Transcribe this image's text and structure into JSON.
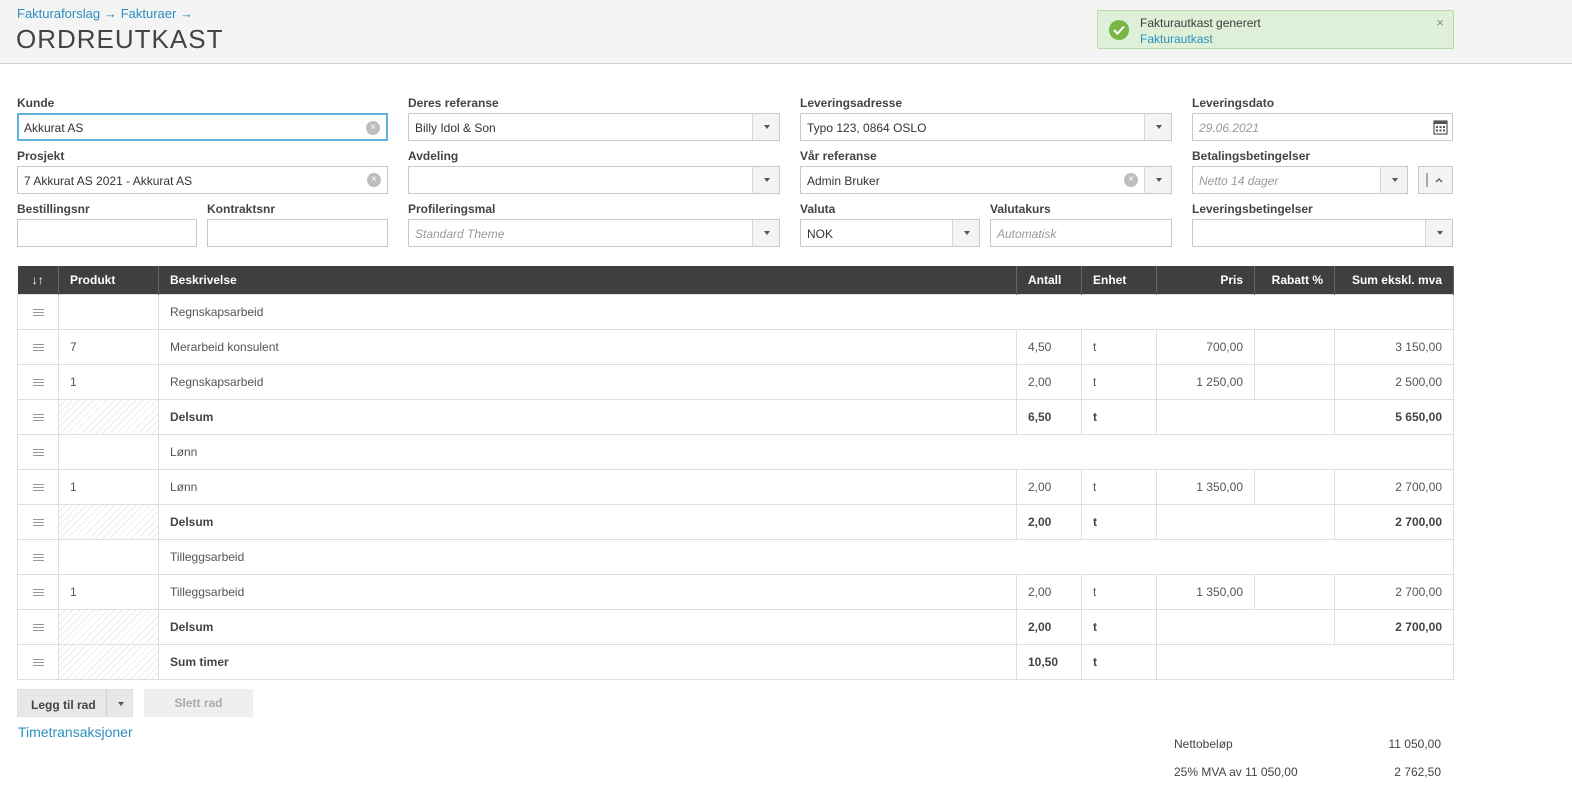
{
  "breadcrumb": [
    "Fakturaforslag →",
    "Fakturaer →"
  ],
  "page_title": "ORDREUTKAST",
  "toast": {
    "title": "Fakturautkast generert",
    "link": "Fakturautkast",
    "close": "×"
  },
  "form": {
    "kunde": {
      "label": "Kunde",
      "value": "Akkurat AS"
    },
    "deres_referanse": {
      "label": "Deres referanse",
      "value": "Billy Idol & Son"
    },
    "leveringsadresse": {
      "label": "Leveringsadresse",
      "value": "Typo 123, 0864 OSLO"
    },
    "leveringsdato": {
      "label": "Leveringsdato",
      "placeholder": "29.06.2021"
    },
    "prosjekt": {
      "label": "Prosjekt",
      "value": "7 Akkurat AS 2021 - Akkurat AS"
    },
    "avdeling": {
      "label": "Avdeling",
      "value": ""
    },
    "var_referanse": {
      "label": "Vår referanse",
      "value": "Admin Bruker"
    },
    "betalingsbetingelser": {
      "label": "Betalingsbetingelser",
      "placeholder": "Netto 14 dager"
    },
    "bestillingsnr": {
      "label": "Bestillingsnr",
      "value": ""
    },
    "kontraktsnr": {
      "label": "Kontraktsnr",
      "value": ""
    },
    "profileringsmal": {
      "label": "Profileringsmal",
      "placeholder": "Standard Theme"
    },
    "valuta": {
      "label": "Valuta",
      "value": "NOK"
    },
    "valutakurs": {
      "label": "Valutakurs",
      "placeholder": "Automatisk"
    },
    "leveringsbetingelser": {
      "label": "Leveringsbetingelser",
      "value": ""
    }
  },
  "table": {
    "columns": [
      "↓↑",
      "Produkt",
      "Beskrivelse",
      "Antall",
      "Enhet",
      "Pris",
      "Rabatt %",
      "Sum ekskl. mva"
    ],
    "rows": [
      {
        "kind": "header",
        "produkt": "",
        "beskrivelse": "Regnskapsarbeid"
      },
      {
        "kind": "line",
        "produkt": "7",
        "beskrivelse": "Merarbeid konsulent",
        "antall": "4,50",
        "enhet": "t",
        "pris": "700,00",
        "rabatt": "",
        "sum": "3 150,00"
      },
      {
        "kind": "line",
        "produkt": "1",
        "beskrivelse": "Regnskapsarbeid",
        "antall": "2,00",
        "enhet": "t",
        "pris": "1 250,00",
        "rabatt": "",
        "sum": "2 500,00"
      },
      {
        "kind": "sub",
        "beskrivelse": "Delsum",
        "antall": "6,50",
        "enhet": "t",
        "sum": "5 650,00"
      },
      {
        "kind": "header",
        "produkt": "",
        "beskrivelse": "Lønn"
      },
      {
        "kind": "line",
        "produkt": "1",
        "beskrivelse": "Lønn",
        "antall": "2,00",
        "enhet": "t",
        "pris": "1 350,00",
        "rabatt": "",
        "sum": "2 700,00"
      },
      {
        "kind": "sub",
        "beskrivelse": "Delsum",
        "antall": "2,00",
        "enhet": "t",
        "sum": "2 700,00"
      },
      {
        "kind": "header",
        "produkt": "",
        "beskrivelse": "Tilleggsarbeid"
      },
      {
        "kind": "line",
        "produkt": "1",
        "beskrivelse": "Tilleggsarbeid",
        "antall": "2,00",
        "enhet": "t",
        "pris": "1 350,00",
        "rabatt": "",
        "sum": "2 700,00"
      },
      {
        "kind": "sub",
        "beskrivelse": "Delsum",
        "antall": "2,00",
        "enhet": "t",
        "sum": "2 700,00"
      },
      {
        "kind": "total",
        "beskrivelse": "Sum timer",
        "antall": "10,50",
        "enhet": "t"
      }
    ]
  },
  "actions": {
    "add_row": "Legg til rad",
    "delete_row": "Slett rad",
    "time_link": "Timetransaksjoner"
  },
  "totals": [
    {
      "label": "Nettobeløp",
      "value": "11 050,00"
    },
    {
      "label": "25% MVA av 11 050,00",
      "value": "2 762,50"
    }
  ],
  "colors": {
    "accent": "#2a8fbd",
    "header_bg": "#3f3f3f",
    "toast_bg": "#dff0d8",
    "check": "#7ab646"
  }
}
